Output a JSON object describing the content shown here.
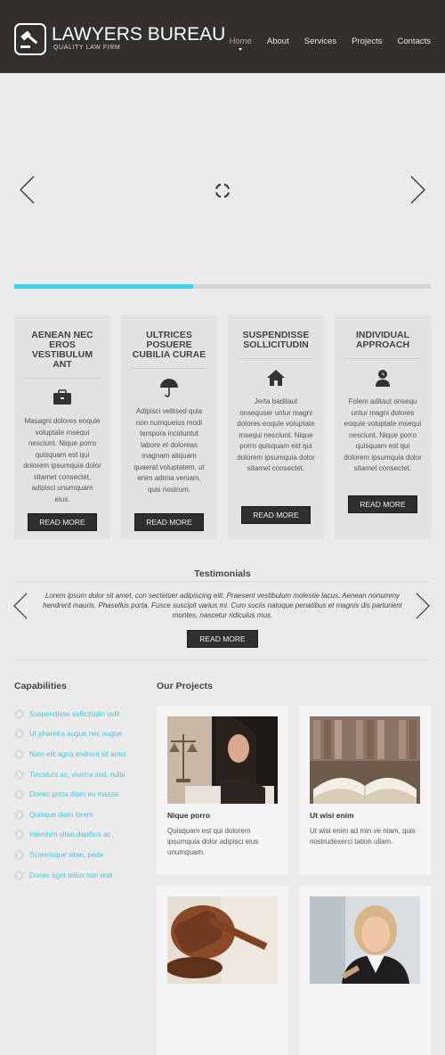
{
  "header": {
    "title": "LAWYERS BUREAU",
    "subtitle": "QUALITY LAW FIRM",
    "nav": [
      "Home",
      "About",
      "Services",
      "Projects",
      "Contacts"
    ]
  },
  "slider": {
    "progress": 0.43
  },
  "features": [
    {
      "title": "AENEAN NEC EROS VESTIBULUM ANT",
      "text": "Masagni dolores eoquie voluptate msequi nesciunt. Nique porro quisquam est qui dolorem ipsumquia dolor sitamet consectet, adipisci unumquam eius.",
      "button": "READ MORE",
      "icon": "briefcase-icon"
    },
    {
      "title": "ULTRICES POSUERE CUBILIA CURAE",
      "text": "Adipisci velitsed quia non numqueius modi tempora inciduntut labore et doloreas magnam aliquam quaerat voluptatem. ut enim adima veniam, quis nostrum.",
      "button": "READ MORE",
      "icon": "umbrella-icon"
    },
    {
      "title": "SUSPENDISSE SOLLICITUDIN",
      "text": "Jerta baditaut onsequser untur magni dolores eoquie voluptate msequi nesciunt. Nique porro quisquam est qui dolorem ipsumquia dolor sitamet consectet.",
      "button": "READ MORE",
      "icon": "home-icon"
    },
    {
      "title": "INDIVIDUAL APPROACH",
      "text": "Folem aditaut onsequ untur magni dolores eoquie voluptate msequi nesciunt. Nique porro quisquam est qui dolorem ipsumquia dolor sitamet consectet.",
      "button": "READ MORE",
      "icon": "user-clock-icon"
    }
  ],
  "testimonials": {
    "title": "Testimonials",
    "text": "Lorem ipsum dolor sit amet, con sectetuer adipiscing elit. Praesent vestibulum molestie lacus. Aenean nonummy hendrerit mauris. Phasellus porta. Fusce suscipit varius mi. Cum sociis natoque penatibus et magnis dis parturient montes, nascetur ridiculus mus.",
    "button": "READ MORE"
  },
  "capabilities": {
    "title": "Capabilities",
    "items": [
      "Suspendisse sollicitudin velit",
      "Ut pharetra augue nec augue",
      "Nam elit agna,endrerit sit amet",
      "Tincidunt ac, viverra sed, nulla",
      "Donec porta diam eu massa",
      "Quisque diam lorem",
      "Interdum vitae,dapibus ac",
      "Scelerisque vitae, pede",
      "Donec eget tellus non erat"
    ]
  },
  "projects": {
    "title": "Our Projects",
    "items": [
      {
        "name": "Nique porro",
        "desc": "Quisquam est qui dolorem ipsumquia dolor adipisci eius unumquam."
      },
      {
        "name": "Ut wisi enim",
        "desc": "Ut wisi enim ad min ve niam, quis nostrudexerci tation ullam."
      },
      {
        "name": "",
        "desc": ""
      },
      {
        "name": "",
        "desc": ""
      }
    ]
  },
  "colors": {
    "header_bg": "#332f2c",
    "accent": "#3bd3eb",
    "link": "#47c6de",
    "button_bg": "#2f2f2f"
  }
}
